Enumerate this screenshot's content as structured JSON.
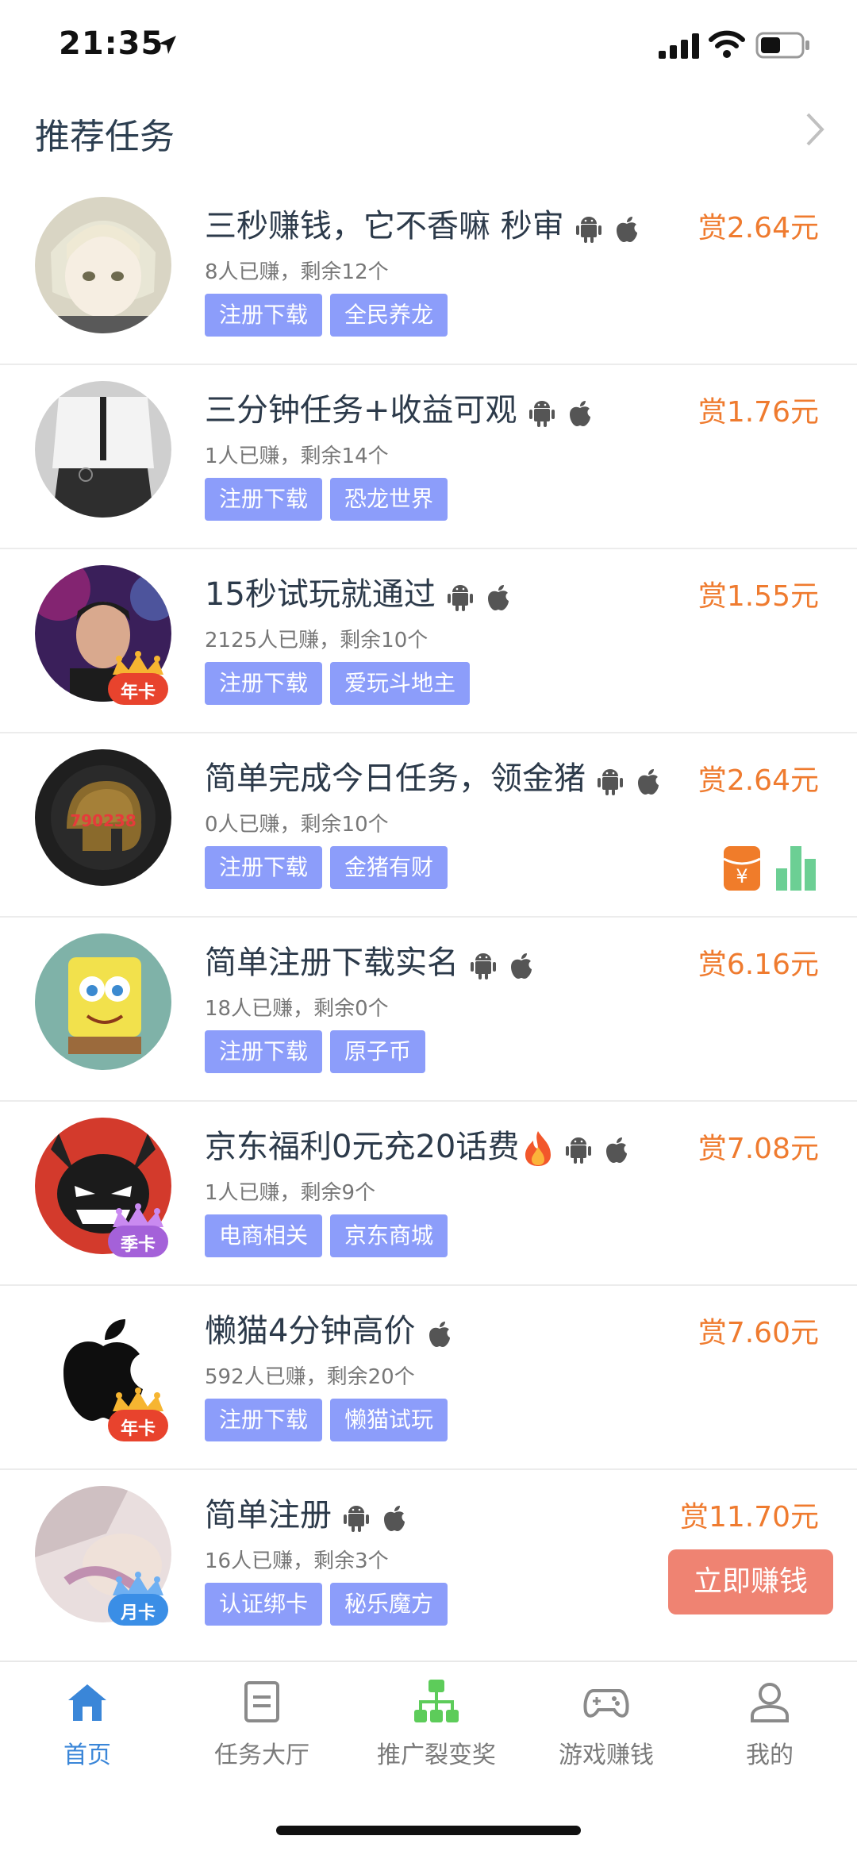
{
  "status_bar": {
    "time": "21:35"
  },
  "header": {
    "title": "推荐任务"
  },
  "tasks": [
    {
      "title": "三秒赚钱，它不香嘛 秒审",
      "meta": "8人已赚，剩余12个",
      "tags": [
        "注册下载",
        "全民养龙"
      ],
      "reward": "赏2.64元",
      "platforms": [
        "android",
        "apple"
      ]
    },
    {
      "title": "三分钟任务+收益可观",
      "meta": "1人已赚，剩余14个",
      "tags": [
        "注册下载",
        "恐龙世界"
      ],
      "reward": "赏1.76元",
      "platforms": [
        "android",
        "apple"
      ]
    },
    {
      "title": "15秒试玩就通过",
      "meta": "2125人已赚，剩余10个",
      "tags": [
        "注册下载",
        "爱玩斗地主"
      ],
      "reward": "赏1.55元",
      "platforms": [
        "android",
        "apple"
      ],
      "badge": "年卡"
    },
    {
      "title": "简单完成今日任务，领金猪",
      "meta": "0人已赚，剩余10个",
      "tags": [
        "注册下载",
        "金猪有财"
      ],
      "reward": "赏2.64元",
      "platforms": [
        "android",
        "apple"
      ],
      "avatar_text": "790238"
    },
    {
      "title": "简单注册下载实名",
      "meta": "18人已赚，剩余0个",
      "tags": [
        "注册下载",
        "原子币"
      ],
      "reward": "赏6.16元",
      "platforms": [
        "android",
        "apple"
      ]
    },
    {
      "title": "京东福利0元充20话费",
      "meta": "1人已赚，剩余9个",
      "tags": [
        "电商相关",
        "京东商城"
      ],
      "reward": "赏7.08元",
      "platforms": [
        "android",
        "apple"
      ],
      "badge": "季卡"
    },
    {
      "title": "懒猫4分钟高价",
      "meta": "592人已赚，剩余20个",
      "tags": [
        "注册下载",
        "懒猫试玩"
      ],
      "reward": "赏7.60元",
      "platforms": [
        "apple"
      ],
      "badge": "年卡"
    },
    {
      "title": "简单注册",
      "meta": "16人已赚，剩余3个",
      "tags": [
        "认证绑卡",
        "秘乐魔方"
      ],
      "reward": "赏11.70元",
      "platforms": [
        "android",
        "apple"
      ],
      "badge": "月卡"
    }
  ],
  "cta": {
    "label": "立即赚钱"
  },
  "tabbar": [
    {
      "label": "首页",
      "icon": "home-icon",
      "active": true
    },
    {
      "label": "任务大厅",
      "icon": "document-icon"
    },
    {
      "label": "推广裂变奖",
      "icon": "network-icon"
    },
    {
      "label": "游戏赚钱",
      "icon": "gamepad-icon"
    },
    {
      "label": "我的",
      "icon": "user-icon"
    }
  ],
  "colors": {
    "accent": "#3a86d8",
    "reward": "#ef7b2f",
    "tag": "#8c9dfa",
    "cta": "#ef8372"
  }
}
